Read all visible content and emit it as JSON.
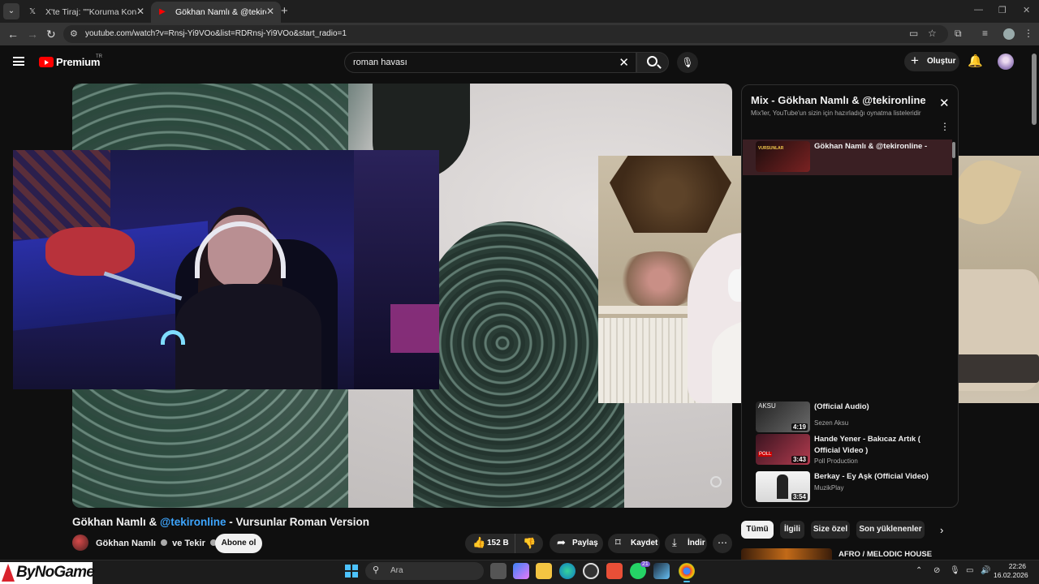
{
  "browser": {
    "tabs": [
      {
        "title": "X'te Tiraj: \"\"Koruma Konusunda",
        "icon": "x-logo-icon",
        "active": false
      },
      {
        "title": "Gökhan Namlı & @tekironline",
        "icon": "youtube-icon",
        "active": true
      }
    ],
    "url": "youtube.com/watch?v=Rnsj-Yi9VOo&list=RDRnsj-Yi9VOo&start_radio=1"
  },
  "yt_header": {
    "logo_text": "Premium",
    "logo_region": "TR",
    "search_value": "roman havası",
    "create_label": "Oluştur"
  },
  "video": {
    "title_prefix": "Gökhan Namlı & ",
    "title_mention": "@tekironline",
    "title_suffix": " - Vursunlar Roman Version",
    "channel": "Gökhan Namlı ",
    "channel_and": " ve Tekir ",
    "subscribe_label": "Abone ol",
    "likes": "152 B",
    "share_label": "Paylaş",
    "save_label": "Kaydet",
    "download_label": "İndir"
  },
  "mix": {
    "title": "Mix - Gökhan Namlı & @tekironline ...",
    "subtitle": "Mix'ler, YouTube'un sizin için hazırladığı oynatma listeleridir",
    "items": [
      {
        "title": "Gökhan Namlı & @tekironline -",
        "channel": "",
        "duration": "",
        "thumb_text": "VURSUNLAR"
      },
      {
        "title": "(Official Audio)",
        "channel": "Sezen Aksu",
        "duration": "4:19",
        "thumb_text": "AKSU"
      },
      {
        "title": "Hande Yener - Bakıcaz Artık ( Official Video )",
        "channel": "Poll Production",
        "duration": "3:43",
        "thumb_text": "POLL"
      },
      {
        "title": "Berkay - Ey Aşk (Official Video)",
        "channel": "MuzikPlay",
        "duration": "3:54",
        "thumb_text": ""
      }
    ]
  },
  "chips": [
    "Tümü",
    "İlgili",
    "Size özel",
    "Son yüklenenler"
  ],
  "recommendation": {
    "title": "AFRO / MELODIC HOUSE"
  },
  "overlay": {
    "brand": "ByNoGame"
  },
  "taskbar": {
    "search_placeholder": "Ara",
    "whatsapp_badge": "21",
    "time": "22:26",
    "date": "16.02.2026"
  },
  "colors": {
    "accent": "#3ea6ff",
    "brand_red": "#ff0000",
    "taskbar_accent": "#4cc2ff"
  }
}
